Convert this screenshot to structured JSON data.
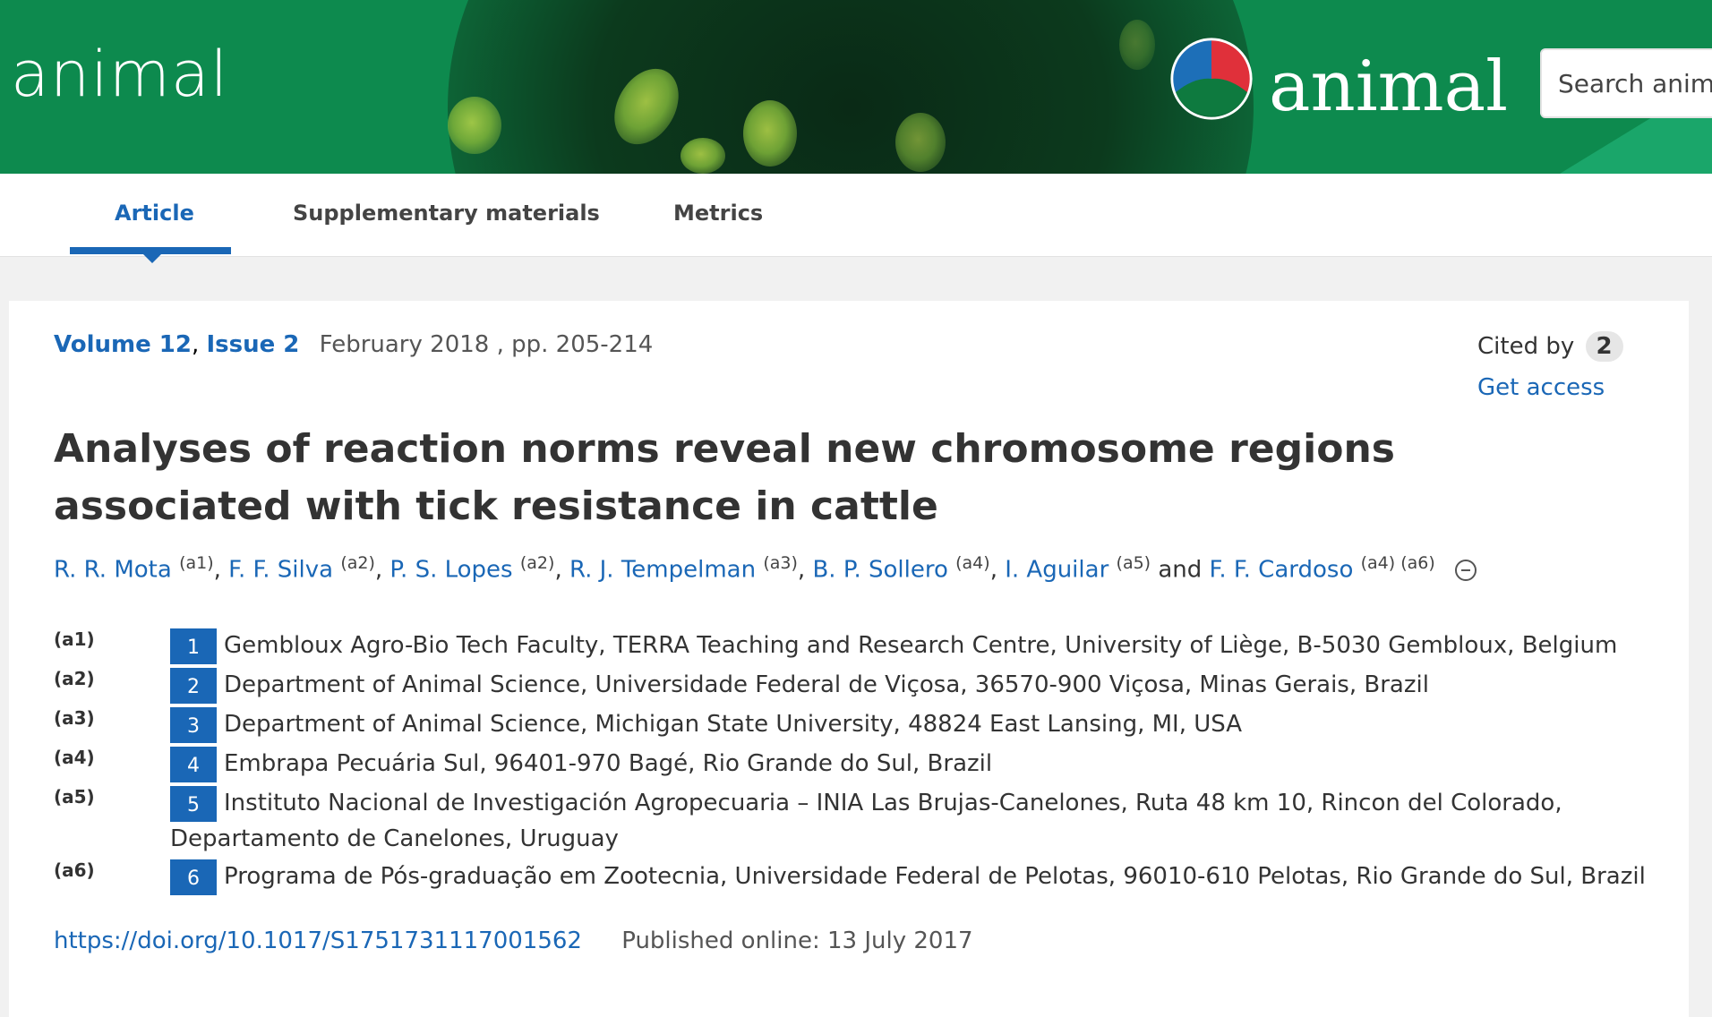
{
  "header": {
    "site_name": "animal",
    "brand_word": "animal",
    "search_placeholder": "Search animal"
  },
  "tabs": [
    {
      "label": "Article",
      "active": true
    },
    {
      "label": "Supplementary materials",
      "active": false
    },
    {
      "label": "Metrics",
      "active": false
    }
  ],
  "article": {
    "volume": "Volume 12",
    "issue": "Issue 2",
    "date_pages": "February 2018 , pp. 205-214",
    "cited_by_label": "Cited by",
    "cited_by_count": "2",
    "get_access": "Get access",
    "title": "Analyses of reaction norms reveal new chromosome regions associated with tick resistance in cattle",
    "authors": [
      {
        "name": "R. R. Mota",
        "aff": "(a1)"
      },
      {
        "name": "F. F. Silva",
        "aff": "(a2)"
      },
      {
        "name": "P. S. Lopes",
        "aff": "(a2)"
      },
      {
        "name": "R. J. Tempelman",
        "aff": "(a3)"
      },
      {
        "name": "B. P. Sollero",
        "aff": "(a4)"
      },
      {
        "name": "I. Aguilar",
        "aff": "(a5)"
      },
      {
        "name": "F. F. Cardoso",
        "aff": "(a4) (a6)"
      }
    ],
    "and_word": "and",
    "affiliations": [
      {
        "code": "(a1)",
        "num": "1",
        "text": "Gembloux Agro-Bio Tech Faculty, TERRA Teaching and Research Centre, University of Liège, B-5030 Gembloux, Belgium"
      },
      {
        "code": "(a2)",
        "num": "2",
        "text": "Department of Animal Science, Universidade Federal de Viçosa, 36570-900 Viçosa, Minas Gerais, Brazil"
      },
      {
        "code": "(a3)",
        "num": "3",
        "text": "Department of Animal Science, Michigan State University, 48824 East Lansing, MI, USA"
      },
      {
        "code": "(a4)",
        "num": "4",
        "text": "Embrapa Pecuária Sul, 96401-970 Bagé, Rio Grande do Sul, Brazil"
      },
      {
        "code": "(a5)",
        "num": "5",
        "text": "Instituto Nacional de Investigación Agropecuaria – INIA Las Brujas-Canelones, Ruta 48 km 10, Rincon del Colorado,",
        "text_cont": "Departamento de Canelones, Uruguay"
      },
      {
        "code": "(a6)",
        "num": "6",
        "text": "Programa de Pós-graduação em Zootecnia, Universidade Federal de Pelotas, 96010-610 Pelotas, Rio Grande do Sul, Brazil"
      }
    ],
    "doi": "https://doi.org/10.1017/S1751731117001562",
    "published": "Published online: 13 July 2017"
  },
  "colors": {
    "accent": "#1a67b6",
    "banner": "#0d8a4e"
  }
}
